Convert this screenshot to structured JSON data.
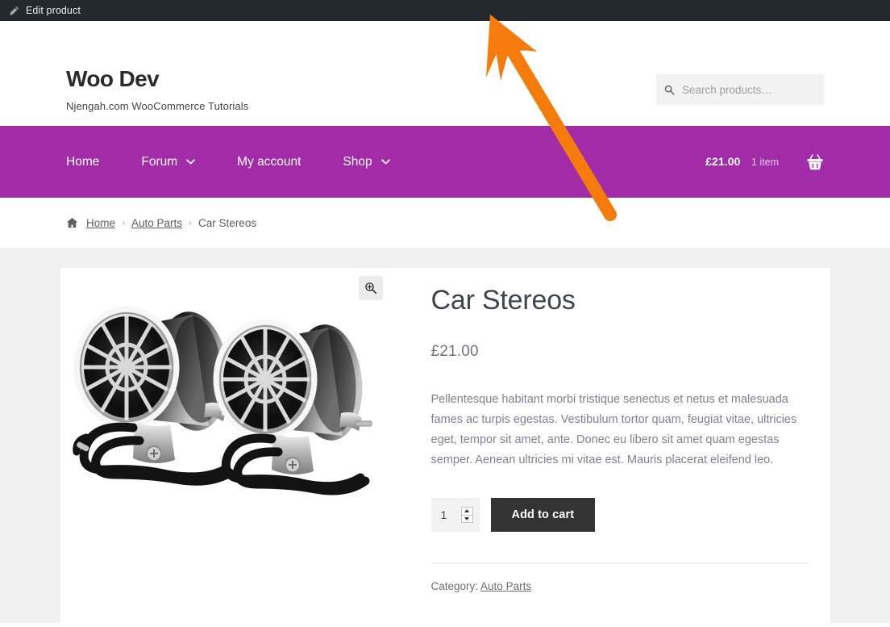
{
  "admin_bar": {
    "edit_link_label": "Edit product",
    "icon": "pencil-icon",
    "background": "#23282d"
  },
  "header": {
    "site_title": "Woo Dev",
    "tagline": "Njengah.com WooCommerce Tutorials",
    "search": {
      "placeholder": "Search products…",
      "value": "",
      "icon": "search-icon"
    }
  },
  "nav": {
    "background": "#a22ba8",
    "items": [
      {
        "label": "Home",
        "has_dropdown": false
      },
      {
        "label": "Forum",
        "has_dropdown": true
      },
      {
        "label": "My account",
        "has_dropdown": false
      },
      {
        "label": "Shop",
        "has_dropdown": true
      }
    ],
    "cart": {
      "amount": "£21.00",
      "count": "1 item",
      "icon": "shopping-basket-icon"
    }
  },
  "breadcrumb": {
    "home_icon": "house-icon",
    "separator": "›",
    "items": [
      {
        "label": "Home",
        "is_link": true
      },
      {
        "label": "Auto Parts",
        "is_link": true
      },
      {
        "label": "Car Stereos",
        "is_link": false
      }
    ]
  },
  "product": {
    "title": "Car Stereos",
    "price": "£21.00",
    "description": "Pellentesque habitant morbi tristique senectus et netus et malesuada fames ac turpis egestas. Vestibulum tortor quam, feugiat vitae, ultricies eget, tempor sit amet, ante. Donec eu libero sit amet quam egestas semper. Aenean ultricies mi vitae est. Mauris placerat eleifend leo.",
    "quantity": "1",
    "add_to_cart_label": "Add to cart",
    "gallery": {
      "zoom_icon": "magnifier-plus-icon",
      "image_alt": "Pair of chrome car speakers with black cables"
    },
    "meta": {
      "category_label": "Category:",
      "category_value": "Auto Parts"
    }
  },
  "annotation": {
    "arrow_color": "#f57c0a",
    "points_to": "admin-bar-edit-product"
  }
}
